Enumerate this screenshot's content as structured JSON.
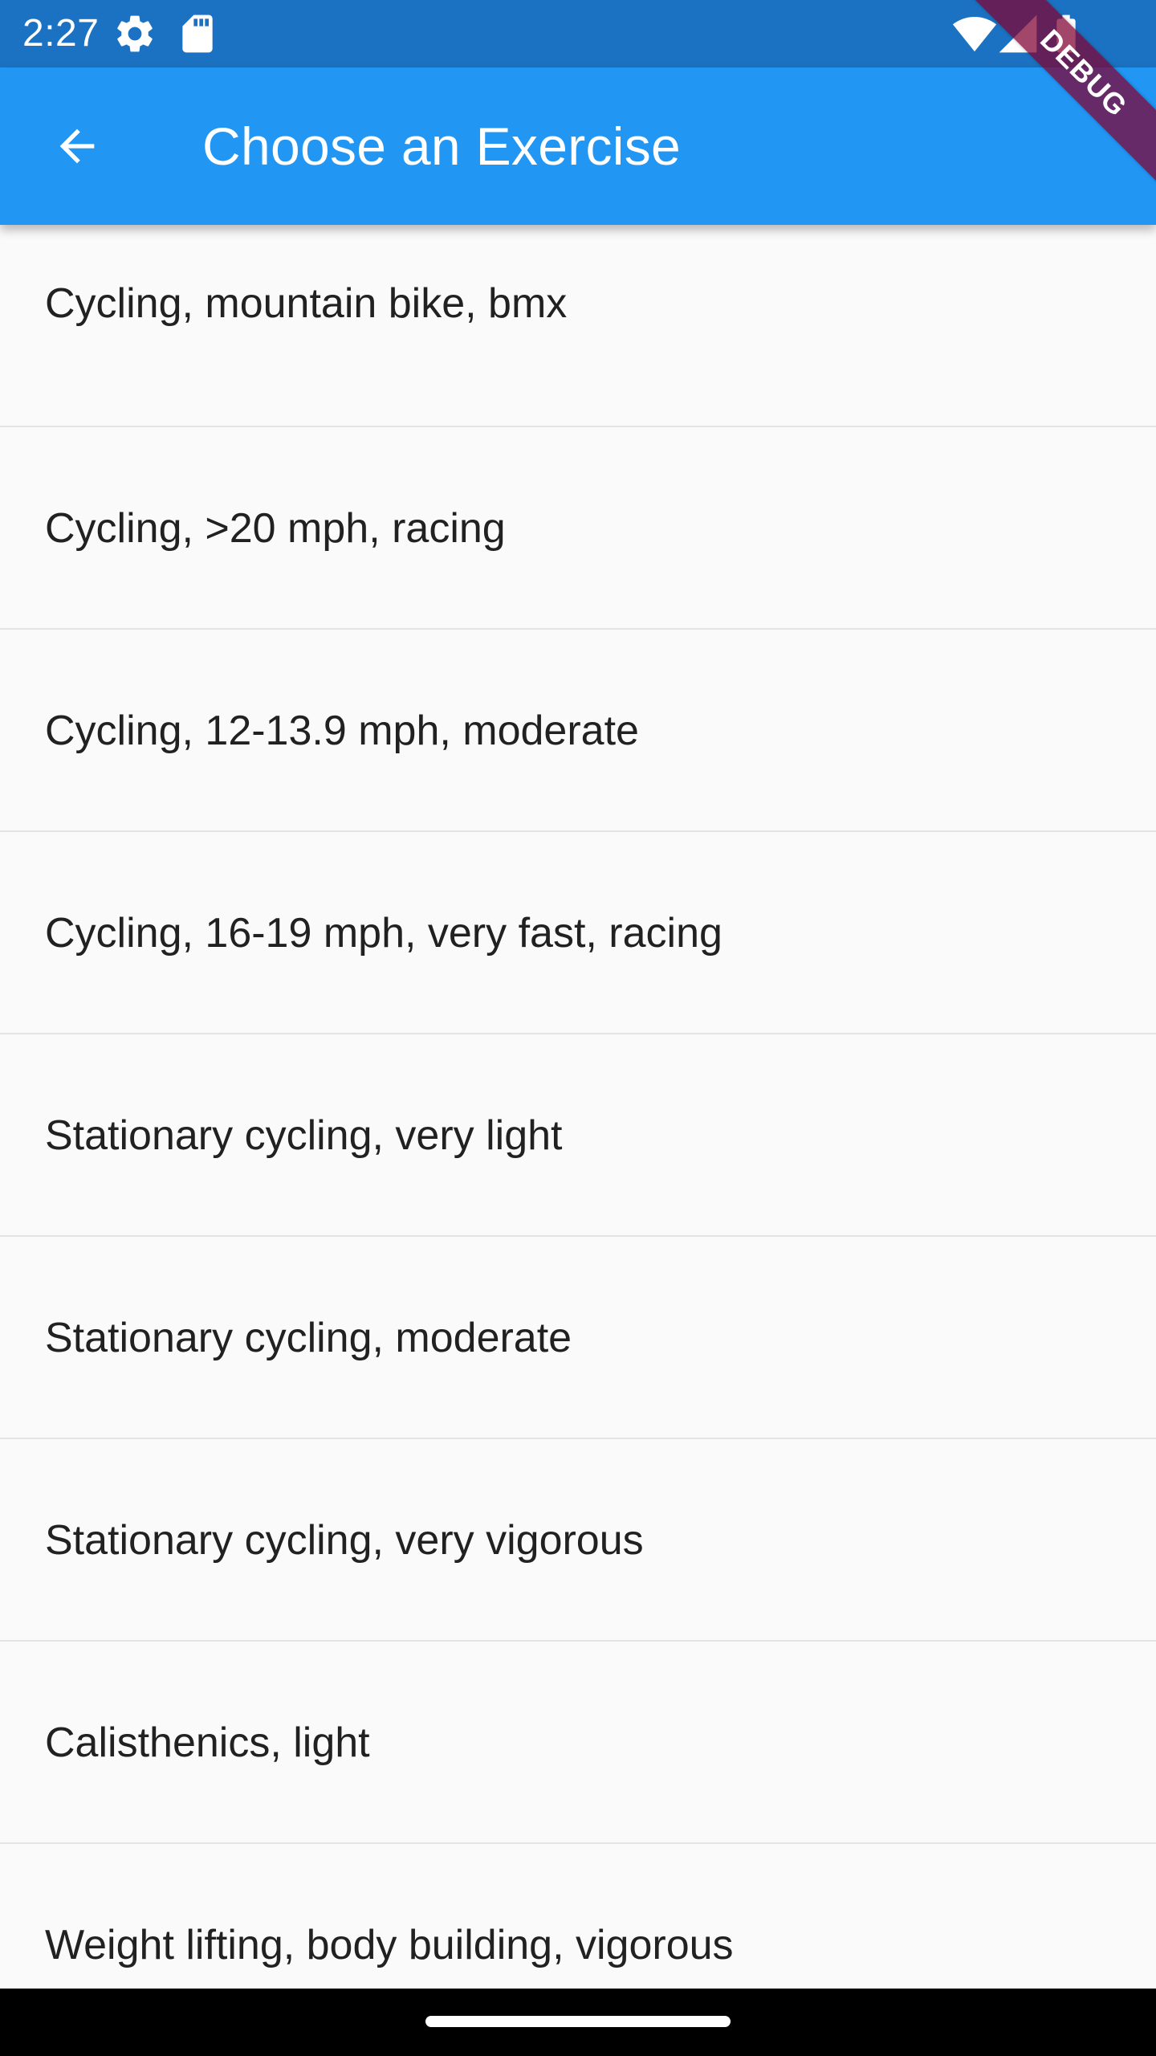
{
  "status_bar": {
    "time": "2:27",
    "background_color": "#1c72c2",
    "left_icons": [
      "settings-gear-icon",
      "sd-card-icon"
    ],
    "right_icons": [
      "wifi-icon",
      "cell-signal-icon",
      "battery-icon"
    ]
  },
  "app_bar": {
    "title": "Choose an Exercise",
    "back_icon": "arrow-back-icon",
    "background_color": "#2196f3"
  },
  "debug_banner": {
    "label": "DEBUG"
  },
  "exercises": [
    "Cycling, mountain bike, bmx",
    "Cycling, >20 mph, racing",
    "Cycling, 12-13.9 mph, moderate",
    "Cycling, 16-19 mph, very fast, racing",
    "Stationary cycling, very light",
    "Stationary cycling, moderate",
    "Stationary cycling, very vigorous",
    "Calisthenics, light",
    "Weight lifting, body building, vigorous"
  ],
  "nav_bar": {
    "home_indicator": "home-indicator-pill"
  }
}
